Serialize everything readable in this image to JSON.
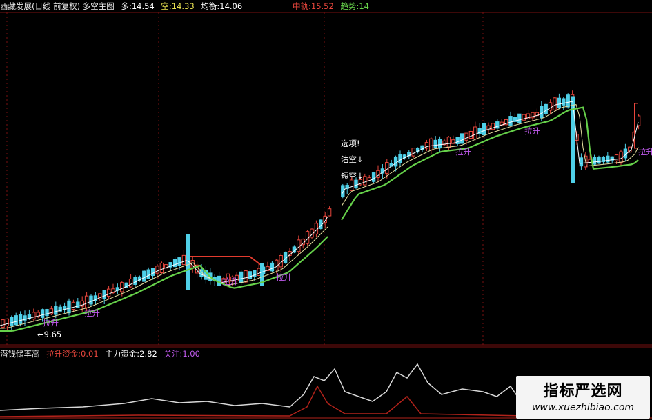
{
  "header": {
    "title": "西藏发展(日线 前复权) 多空主图",
    "duo_label": "多:",
    "duo_value": "14.54",
    "kong_label": "空:",
    "kong_value": "14.33",
    "junheng_label": "均衡:",
    "junheng_value": "14.06",
    "zhongzhou_label": "中轨:",
    "zhongzhou_value": "15.52",
    "qushi_label": "趋势:",
    "qushi_value": "14"
  },
  "annotations": {
    "low_price": "←9.65",
    "lasheng": "拉升",
    "xuanxiang": "选项!",
    "guakong": "沽空↓",
    "duankong": "短空↓"
  },
  "sub_header": {
    "title": "潜钱储率高",
    "lasheng_label": "拉升资金:",
    "lasheng_value": "0.01",
    "zhuli_label": "主力资金:",
    "zhuli_value": "2.82",
    "guanzhu_label": "关注:",
    "guanzhu_value": "1.00"
  },
  "watermark": {
    "line1": "指标严选网",
    "line2": "www.xuezhibiao.com"
  },
  "colors": {
    "bg": "#000000",
    "grid": "#7a1010",
    "up": "#e8463c",
    "down": "#4fd0e8",
    "ma_fast": "#ffffff",
    "ma_mid": "#e8e0a0",
    "ma_slow": "#66d14a",
    "resist": "#e23b2e",
    "lasheng": "#c25bf0",
    "osc": "#d8d8d8",
    "osc2": "#b2221a"
  },
  "chart_data": [
    {
      "type": "candlestick",
      "title": "西藏发展(日线 前复权) 多空主图",
      "price_range": [
        9.3,
        16.2
      ],
      "low_marker": 9.65,
      "series": [
        {
          "name": "多",
          "last": 14.54
        },
        {
          "name": "空",
          "last": 14.33
        },
        {
          "name": "均衡",
          "last": 14.06
        },
        {
          "name": "中轨",
          "last": 15.52
        },
        {
          "name": "趋势",
          "last": 14
        }
      ]
    },
    {
      "type": "line",
      "title": "潜钱储率高",
      "series": [
        {
          "name": "拉升资金",
          "last": 0.01
        },
        {
          "name": "主力资金",
          "last": 2.82
        },
        {
          "name": "关注",
          "last": 1.0
        }
      ]
    }
  ]
}
